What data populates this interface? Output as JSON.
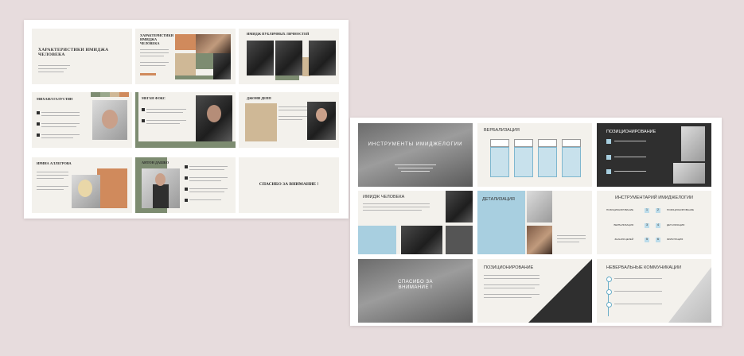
{
  "sheet_a": {
    "title_slide": {
      "title": "ХАРАКТЕРИСТИКИ ИМИДЖА ЧЕЛОВЕКА"
    },
    "char_slide": {
      "title": "ХАРАКТЕРИСТИКИ ИМИДЖА ЧЕЛОВЕКА"
    },
    "public_slide": {
      "title": "ИМИДЖ ПУБЛИЧНЫХ ЛИЧНОСТЕЙ"
    },
    "galustyan": {
      "name": "МИХАИЛ ГАЛУСТЯН"
    },
    "fox": {
      "name": "МЕГАН ФОКС"
    },
    "depp": {
      "name": "ДЖОНИ ДЕПП"
    },
    "allegrova": {
      "name": "ИРИНА АЛЛЕГРОВА"
    },
    "dashko": {
      "name": "АНТОН ДАШКО"
    },
    "thanks": {
      "text": "СПАСИБО ЗА ВНИМАНИЕ !"
    }
  },
  "sheet_b": {
    "tools": {
      "title": "ИНСТРУМЕНТЫ ИМИДЖЕЛОГИИ"
    },
    "verbal": {
      "title": "ВЕРБАЛИЗАЦИЯ"
    },
    "position": {
      "title": "ПОЗИЦИОНИРОВАНИЕ"
    },
    "image": {
      "title": "ИМИДЖ ЧЕЛОВЕКА"
    },
    "detail": {
      "title": "ДЕТАЛИЗАЦИЯ"
    },
    "toolkit": {
      "title": "ИНСТРУМЕНТАРИЙ ИМИДЖЕЛОГИИ",
      "left_labels": [
        "ПОЗИЦИОНИРОВАНИЕ",
        "ВЕРБАЛИЗАЦИЯ",
        "ЗНАНИЯ ЦЕЛЕЙ"
      ],
      "right_labels": [
        "ПОЗИЦИОНИРОВАНИЕ",
        "ДЕТАЛИЗАЦИЯ",
        "ФИЛЬТРАЦИЯ"
      ],
      "numbers": [
        "1",
        "2",
        "3",
        "4",
        "5",
        "6"
      ]
    },
    "thanks": {
      "text": "СПАСИБО ЗА ВНИМАНИЕ !"
    },
    "position2": {
      "title": "ПОЗИЦИОНИРОВАНИЕ"
    },
    "nonverbal": {
      "title": "НЕВЕРБАЛЬНЫЕ КОММУНИКАЦИИ"
    }
  }
}
